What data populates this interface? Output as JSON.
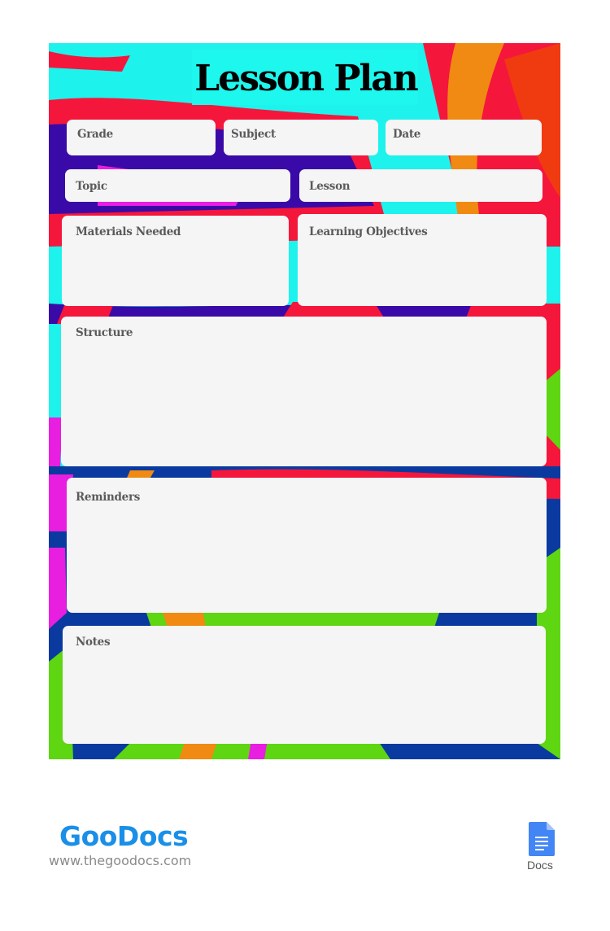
{
  "document": {
    "title": "Lesson Plan",
    "fields": {
      "grade": "Grade",
      "subject": "Subject",
      "date": "Date",
      "topic": "Topic",
      "lesson": "Lesson",
      "materials": "Materials Needed",
      "objectives": "Learning Objectives",
      "structure": "Structure",
      "reminders": "Reminders",
      "notes": "Notes"
    },
    "colors": {
      "cyan": "#1ef2ec",
      "red": "#f5163c",
      "indigo": "#3a0aa8",
      "magenta": "#e81ee0",
      "orange": "#f08a12",
      "blue": "#0a3aa0",
      "green": "#5ed612",
      "card": "#f5f5f5"
    }
  },
  "footer": {
    "brand": "GooDocs",
    "url": "www.thegoodocs.com",
    "app_label": "Docs"
  }
}
